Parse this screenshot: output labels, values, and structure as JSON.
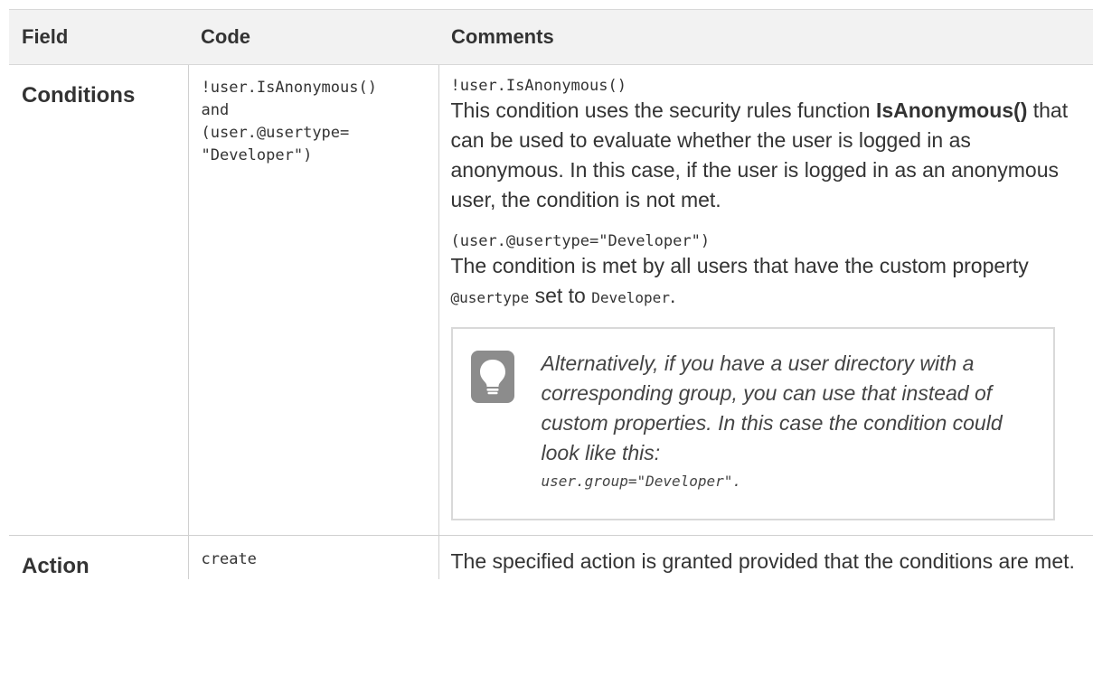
{
  "table": {
    "headers": [
      "Field",
      "Code",
      "Comments"
    ]
  },
  "conditions": {
    "field": "Conditions",
    "code_lines": [
      "!user.IsAnonymous()",
      "and",
      "(user.@usertype=",
      "\"Developer\")"
    ],
    "comment1_code": "!user.IsAnonymous()",
    "comment1_pre": "This condition uses the security rules function ",
    "comment1_bold": "IsAnonymous()",
    "comment1_post": " that can be used to evaluate whether the user is logged in as anonymous. In this case, if the user is logged in as an anonymous user, the condition is not met.",
    "comment2_code": "(user.@usertype=\"Developer\")",
    "comment2_pre": "The condition is met by all users that have the custom property ",
    "comment2_prop": "@usertype",
    "comment2_mid": " set to ",
    "comment2_value": "Developer",
    "comment2_end": ".",
    "tip_text": "Alternatively, if you have a user directory with a corresponding group, you can use that instead of custom properties. In this case the condition could look like this:",
    "tip_code": "user.group=\"Developer\".",
    "tip_icon": "lightbulb-icon"
  },
  "action": {
    "field": "Action",
    "code": "create",
    "comment": "The specified action is granted provided that the conditions are met."
  }
}
